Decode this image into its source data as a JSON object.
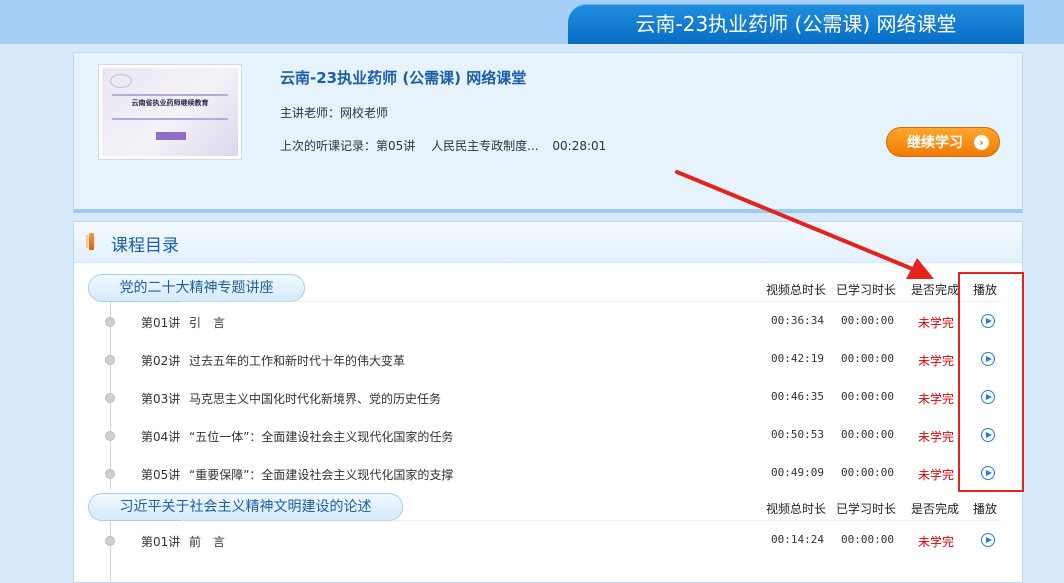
{
  "banner": {
    "title": "云南-23执业药师 (公需课) 网络课堂"
  },
  "course": {
    "thumbnail_text": "云南省执业药师继续教育",
    "title": "云南-23执业药师 (公需课) 网络课堂",
    "teacher": "主讲老师：网校老师",
    "last_record_label": "上次的听课记录：第05讲",
    "last_record_title": "人民民主专政制度...",
    "last_record_time": "00:28:01",
    "continue_label": "继续学习"
  },
  "catalog": {
    "title": "课程目录",
    "columns": [
      "视频总时长",
      "已学习时长",
      "是否完成",
      "播放"
    ],
    "sections": [
      {
        "name": "党的二十大精神专题讲座",
        "lessons": [
          {
            "num": "第01讲",
            "title": "引　言",
            "total": "00:36:34",
            "learned": "00:00:00",
            "status": "未学完"
          },
          {
            "num": "第02讲",
            "title": "过去五年的工作和新时代十年的伟大变革",
            "total": "00:42:19",
            "learned": "00:00:00",
            "status": "未学完"
          },
          {
            "num": "第03讲",
            "title": "马克思主义中国化时代化新境界、党的历史任务",
            "total": "00:46:35",
            "learned": "00:00:00",
            "status": "未学完"
          },
          {
            "num": "第04讲",
            "title": "“五位一体”：全面建设社会主义现代化国家的任务",
            "total": "00:50:53",
            "learned": "00:00:00",
            "status": "未学完"
          },
          {
            "num": "第05讲",
            "title": "“重要保障”：全面建设社会主义现代化国家的支撑",
            "total": "00:49:09",
            "learned": "00:00:00",
            "status": "未学完"
          }
        ]
      },
      {
        "name": "习近平关于社会主义精神文明建设的论述",
        "lessons": [
          {
            "num": "第01讲",
            "title": "前　言",
            "total": "00:14:24",
            "learned": "00:00:00",
            "status": "未学完"
          }
        ]
      }
    ]
  },
  "colors": {
    "accent": "#1a5fa8",
    "banner": "#0a6cc4",
    "status_incomplete": "#e00000",
    "annotation": "#e4231c",
    "continue_button": "#f07b06"
  },
  "icons": [
    "play-icon",
    "arrow-right-icon",
    "section-marker-icon"
  ]
}
